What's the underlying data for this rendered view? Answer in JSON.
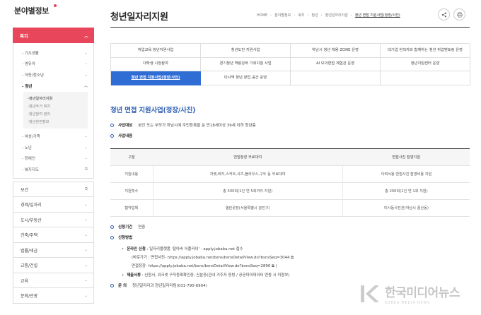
{
  "brand": {
    "name": "분야별정보"
  },
  "sidebar": {
    "open_header": "복지",
    "sub_items": [
      {
        "label": "기초생활",
        "has_arrow": true
      },
      {
        "label": "영유아",
        "has_arrow": true
      },
      {
        "label": "아동/청소년",
        "has_arrow": true
      },
      {
        "label": "청년",
        "has_arrow": true,
        "active": true
      }
    ],
    "nested": [
      "청년일자리지원",
      "청년주거 복지",
      "청년참여 권리",
      "청년관련정보"
    ],
    "sub_items_after": [
      {
        "label": "여성/가족",
        "has_arrow": true
      },
      {
        "label": "노년",
        "has_arrow": true
      },
      {
        "label": "장애인",
        "has_arrow": true
      },
      {
        "label": "복지지도",
        "external": true
      }
    ],
    "groups": [
      "보건",
      "경제/일자리",
      "도시/부동산",
      "건축/주택",
      "법률/세금",
      "교통/건설",
      "교육",
      "문화/관광"
    ]
  },
  "header": {
    "title": "청년일자리지원",
    "breadcrumb": [
      "HOME",
      "분야별정보",
      "복지",
      "청년",
      "청년일자리지원",
      "청년 면접 지원사업(정장/사진)"
    ]
  },
  "tabs": [
    "취업교육 청년지원사업",
    "청년도전 지원사업",
    "하남시 청년 채용 ZONE 운영",
    "대기업 현직자와 함께하는 청년 취업멘토링 운영",
    "대학생 시청참여",
    "경기청년 역량강화 기회지원 사업",
    "AI 모의면접 체험관 운영",
    "청년지원센터 운영",
    "청년 면접 지원사업(정장/사진)",
    "미사역 청년 창업 공간 운영"
  ],
  "active_tab_index": 8,
  "section": {
    "title": "청년 면접 지원사업(정장/사진)",
    "target_label": "사업대상",
    "target_text": "본인 또는 부모가 하남시에 주민등록을 둔 만18세이상 39세 이하 청년층",
    "content_label": "사업내용"
  },
  "table": {
    "headers": [
      "구분",
      "면접정장 무료대여",
      "면접사진 촬영지원"
    ],
    "rows": [
      [
        "지원내용",
        "자켓,바지,스커트,셔츠,블라우스,구두 등 무료대여",
        "이력서용 면접사진 촬영비용 지원"
      ],
      [
        "지원횟수",
        "총 500회(1인 연 5회까지 지원)",
        "총 200회(1인 연 1회 지원)"
      ],
      [
        "협약업체",
        "열린옷장(서울특별시 광진구)",
        "미사동사진관(하남시 풍산동)"
      ]
    ]
  },
  "apply": {
    "period_label": "신청기간",
    "period_value": "연중",
    "method_label": "신청방법",
    "online_label": "온라인 신청",
    "online_text": ": 일자리플랫폼 '잡아바 어플라이' - apply.jobaba.net 접수",
    "photo_link": "(바로가기 : 면접사진- https://apply.jobaba.net/bsns/bsnsDetailView.do?bsnsSeq=3044 ",
    "suit_link": "면접정장- https://apply.jobaba.net/bsns/bsnsDetailView.do?bsnsSeq=2896 ",
    "docs_label": "제출서류",
    "docs_text": ": 신청서, 워크넷 구직등록확인증, 신분증(관내 거주자 증빙 / 공공마이데이터 연동 시 미청부)",
    "contact_label": "문 의",
    "contact_text": "청년일자리과 청년일자리팀(031-790-6904)"
  },
  "watermark": {
    "title": "한국미디어뉴스",
    "subtitle": "KOREA MEDIA NEWS"
  },
  "colors": {
    "accent_red": "#e8465a",
    "accent_blue": "#2f6dd5",
    "title_blue": "#2f5fb3"
  }
}
